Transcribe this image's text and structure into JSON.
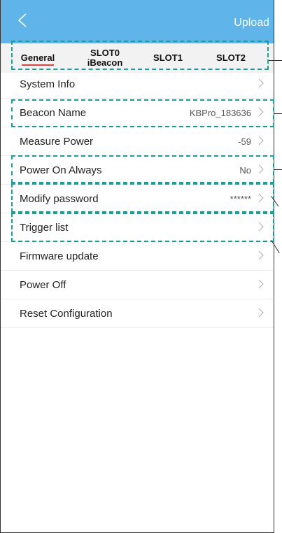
{
  "header": {
    "back_icon": "chevron-left-icon",
    "upload_label": "Upload",
    "color": "#5fb4ea"
  },
  "tabs": [
    {
      "label": "General"
    },
    {
      "label_line1": "SLOT0",
      "label_line2": "iBeacon"
    },
    {
      "label": "SLOT1"
    },
    {
      "label": "SLOT2"
    }
  ],
  "settings": [
    {
      "label": "System Info",
      "value": ""
    },
    {
      "label": "Beacon Name",
      "value": "KBPro_183636"
    },
    {
      "label": "Measure Power",
      "value": "-59"
    },
    {
      "label": "Power On Always",
      "value": "No"
    },
    {
      "label": "Modify password",
      "value": "******"
    },
    {
      "label": "Trigger list",
      "value": ""
    },
    {
      "label": "Firmware update",
      "value": ""
    },
    {
      "label": "Power Off",
      "value": ""
    },
    {
      "label": "Reset Configuration",
      "value": ""
    }
  ],
  "colors": {
    "accent_underline": "#e8413c",
    "highlight": "#12a39a"
  }
}
